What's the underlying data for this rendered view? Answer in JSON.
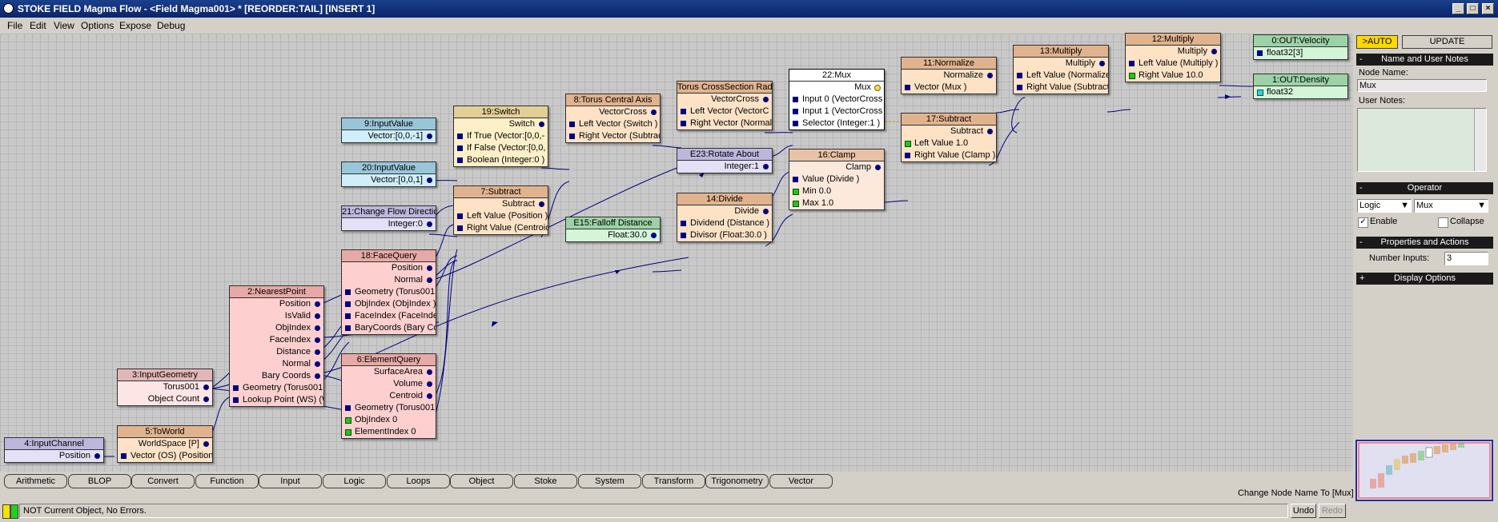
{
  "window": {
    "title": "STOKE FIELD Magma Flow - <Field Magma001> *  [REORDER:TAIL] [INSERT 1]"
  },
  "menu": [
    "File",
    "Edit",
    "View",
    "Options",
    "Expose",
    "Debug"
  ],
  "nodes": {
    "n4": {
      "title": "4:InputChannel",
      "rows": [
        "Position"
      ]
    },
    "n5": {
      "title": "5:ToWorld",
      "rows": [
        "WorldSpace [P]",
        "Vector (OS) (Position"
      ]
    },
    "n3": {
      "title": "3:InputGeometry",
      "rows": [
        "Torus001",
        "Object Count"
      ]
    },
    "n2": {
      "title": "2:NearestPoint",
      "rows": [
        "Position",
        "IsValid",
        "ObjIndex",
        "FaceIndex",
        "Distance",
        "Normal",
        "Bary Coords",
        "Geometry (Torus001",
        "Lookup Point (WS) (W"
      ]
    },
    "n18": {
      "title": "18:FaceQuery",
      "rows": [
        "Position",
        "Normal",
        "Geometry (Torus001",
        "ObjIndex (ObjIndex )",
        "FaceIndex (FaceIndex",
        "BaryCoords (Bary Co"
      ]
    },
    "n6": {
      "title": "6:ElementQuery",
      "rows": [
        "SurfaceArea",
        "Volume",
        "Centroid",
        "Geometry (Torus001",
        "ObjIndex 0",
        "ElementIndex 0"
      ]
    },
    "n9": {
      "title": "9:InputValue",
      "rows": [
        "Vector:[0,0,-1]"
      ]
    },
    "n20": {
      "title": "20:InputValue",
      "rows": [
        "Vector:[0,0,1]"
      ]
    },
    "n21": {
      "title": "21:Change Flow Directio",
      "rows": [
        "Integer:0"
      ]
    },
    "n19": {
      "title": "19:Switch",
      "rows": [
        "Switch",
        "If True (Vector:[0,0,-",
        "If False (Vector:[0,0,",
        "Boolean (Integer:0 )"
      ]
    },
    "n7": {
      "title": "7:Subtract",
      "rows": [
        "Subtract",
        "Left Value (Position )",
        "Right Value (Centroid"
      ]
    },
    "n8": {
      "title": "8:Torus Central Axis",
      "rows": [
        "VectorCross",
        "Left Vector (Switch )",
        "Right Vector (Subtrac"
      ]
    },
    "e15": {
      "title": "E15:Falloff Distance",
      "rows": [
        "Float:30.0"
      ]
    },
    "ntc": {
      "title": "Torus CrossSection Rad",
      "rows": [
        "VectorCross",
        "Left Vector (VectorC",
        "Right Vector (Normal"
      ]
    },
    "e23": {
      "title": "E23:Rotate About",
      "rows": [
        "Integer:1"
      ]
    },
    "n14": {
      "title": "14:Divide",
      "rows": [
        "Divide",
        "Dividend (Distance )",
        "Divisor (Float:30.0 )"
      ]
    },
    "n22": {
      "title": "22:Mux",
      "rows": [
        "Mux",
        "Input 0 (VectorCross",
        "Input 1 (VectorCross",
        "Selector (Integer:1 )"
      ]
    },
    "n16": {
      "title": "16:Clamp",
      "rows": [
        "Clamp",
        "Value (Divide )",
        "Min 0.0",
        "Max 1.0"
      ]
    },
    "n11": {
      "title": "11:Normalize",
      "rows": [
        "Normalize",
        "Vector (Mux )"
      ]
    },
    "n17": {
      "title": "17:Subtract",
      "rows": [
        "Subtract",
        "Left Value 1.0",
        "Right Value (Clamp )"
      ]
    },
    "n13": {
      "title": "13:Multiply",
      "rows": [
        "Multiply",
        "Left Value (Normalize",
        "Right Value (Subtract"
      ]
    },
    "n12": {
      "title": "12:Multiply",
      "rows": [
        "Multiply",
        "Left Value (Multiply )",
        "Right Value 10.0"
      ]
    },
    "n0": {
      "title": "0:OUT:Velocity",
      "rows": [
        "float32[3]"
      ]
    },
    "n1": {
      "title": "1:OUT:Density",
      "rows": [
        "float32"
      ]
    }
  },
  "categories": [
    "Arithmetic",
    "BLOP",
    "Convert",
    "Function",
    "Input",
    "Logic",
    "Loops",
    "Object",
    "Stoke",
    "System",
    "Transform",
    "Trigonometry",
    "Vector"
  ],
  "hint": "Change Node Name To [Mux]",
  "status": {
    "text": "NOT Current Object, No Errors.",
    "undo": "Undo",
    "redo": "Redo"
  },
  "panel": {
    "auto": ">AUTO",
    "update": "UPDATE",
    "sec_name": "Name and User Notes",
    "node_name_label": "Node Name:",
    "node_name": "Mux",
    "user_notes_label": "User Notes:",
    "sec_operator": "Operator",
    "op_category": "Logic",
    "op_type": "Mux",
    "enable": "Enable",
    "collapse": "Collapse",
    "sec_props": "Properties and Actions",
    "num_inputs_label": "Number Inputs:",
    "num_inputs": "3",
    "sec_display": "Display Options",
    "minus": "-",
    "plus": "+"
  },
  "colors": {
    "title_bar": "#0a246a",
    "canvas": "#c9c9c9",
    "wire": "#000080",
    "panel_header": "#1a1a1a",
    "auto_button": "#ffd800"
  }
}
